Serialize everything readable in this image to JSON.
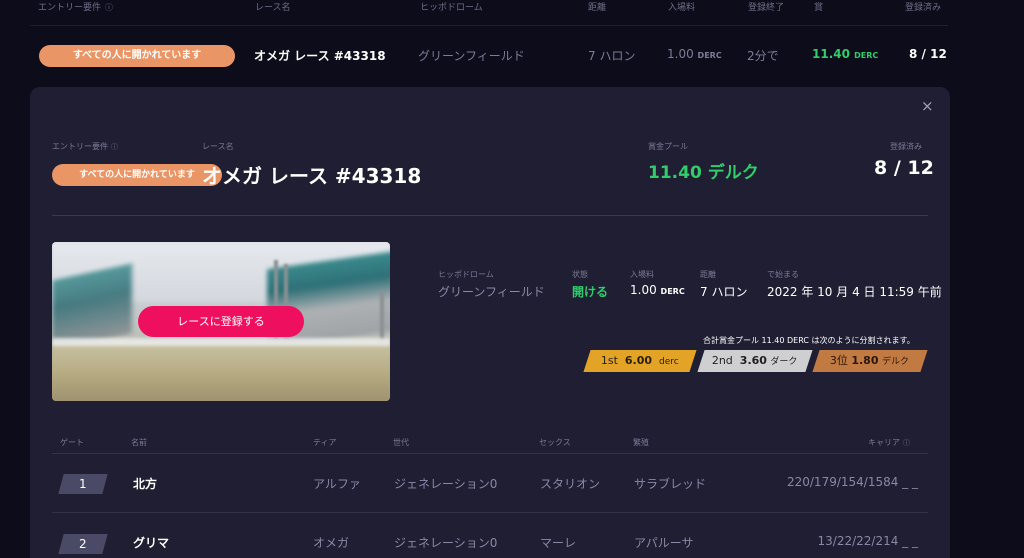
{
  "list": {
    "headers": {
      "entry": "エントリー要件",
      "race_name": "レース名",
      "hippodrome": "ヒッポドローム",
      "distance": "距離",
      "fee": "入場料",
      "closes": "登録終了",
      "prize": "賞",
      "registered": "登録済み"
    },
    "row": {
      "entry": "すべての人に開かれています",
      "race_name": "オメガ レース #43318",
      "hippodrome": "グリーンフィールド",
      "distance": "7 ハロン",
      "fee_value": "1.00",
      "fee_unit": "DERC",
      "closes": "2分で",
      "prize_value": "11.40",
      "prize_unit": "DERC",
      "registered": "8 / 12"
    }
  },
  "panel": {
    "close_icon": "×",
    "entry_label": "エントリー要件",
    "entry_value": "すべての人に開かれています",
    "race_name_label": "レース名",
    "race_name": "オメガ レース #43318",
    "prize_pool_label": "賞金プール",
    "prize_pool_value": "11.40 デルク",
    "registered_label": "登録済み",
    "registered_value": "8 / 12",
    "register_button": "レースに登録する",
    "details": {
      "hippodrome_label": "ヒッポドローム",
      "hippodrome_value": "グリーンフィールド",
      "status_label": "状態",
      "status_value": "開ける",
      "fee_label": "入場料",
      "fee_value": "1.00",
      "fee_unit": "DERC",
      "distance_label": "距離",
      "distance_value": "7 ハロン",
      "start_label": "で始まる",
      "start_value": "2022 年 10 月 4 日 11:59 午前"
    },
    "split_note": "合計賞金プール 11.40 DERC は次のように分割されます。",
    "places": [
      {
        "place": "1st",
        "amount": "6.00",
        "unit": "derc",
        "color": "#e2a326",
        "text_color": "#2b2108"
      },
      {
        "place": "2nd",
        "amount": "3.60",
        "unit": "ダーク",
        "color": "#cfcfd2",
        "text_color": "#1e1e24"
      },
      {
        "place": "3位",
        "amount": "1.80",
        "unit": "デルク",
        "color": "#c27a43",
        "text_color": "#2a1608"
      }
    ],
    "table": {
      "headers": {
        "gate": "ゲート",
        "name": "名前",
        "tier": "ティア",
        "generation": "世代",
        "sex": "セックス",
        "breed": "繁殖",
        "career": "キャリア"
      },
      "rows": [
        {
          "gate": "1",
          "name": "北方",
          "tier": "アルファ",
          "generation": "ジェネレーション0",
          "sex": "スタリオン",
          "breed": "サラブレッド",
          "career": "220/179/154/1584 _ _"
        },
        {
          "gate": "2",
          "name": "グリマ",
          "tier": "オメガ",
          "generation": "ジェネレーション0",
          "sex": "マーレ",
          "breed": "アパルーサ",
          "career": "13/22/22/214 _ _"
        }
      ]
    }
  },
  "colors": {
    "background": "#0d0c1a",
    "panel": "#1f1e32",
    "accent_green": "#32cd6a",
    "accent_pink": "#ee0f5e",
    "pill_orange": "#ea9565"
  }
}
